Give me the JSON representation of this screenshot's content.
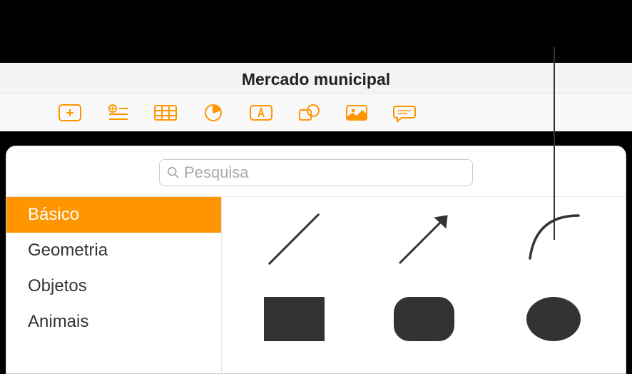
{
  "title": "Mercado municipal",
  "search": {
    "placeholder": "Pesquisa"
  },
  "sidebar": {
    "items": [
      {
        "label": "Básico",
        "selected": true
      },
      {
        "label": "Geometria",
        "selected": false
      },
      {
        "label": "Objetos",
        "selected": false
      },
      {
        "label": "Animais",
        "selected": false
      }
    ]
  },
  "toolbar": {
    "items": [
      {
        "name": "add-button",
        "icon": "plus-square"
      },
      {
        "name": "add-list-button",
        "icon": "plus-list"
      },
      {
        "name": "table-button",
        "icon": "table"
      },
      {
        "name": "chart-button",
        "icon": "pie"
      },
      {
        "name": "text-button",
        "icon": "text-box"
      },
      {
        "name": "shape-button",
        "icon": "shapes"
      },
      {
        "name": "media-button",
        "icon": "image"
      },
      {
        "name": "comment-button",
        "icon": "comment"
      }
    ]
  },
  "shapes": [
    {
      "name": "line-shape",
      "type": "line"
    },
    {
      "name": "arrow-shape",
      "type": "arrow"
    },
    {
      "name": "curve-shape",
      "type": "curve"
    },
    {
      "name": "square-shape",
      "type": "square"
    },
    {
      "name": "rounded-square-shape",
      "type": "rounded"
    },
    {
      "name": "circle-shape",
      "type": "circle"
    }
  ]
}
